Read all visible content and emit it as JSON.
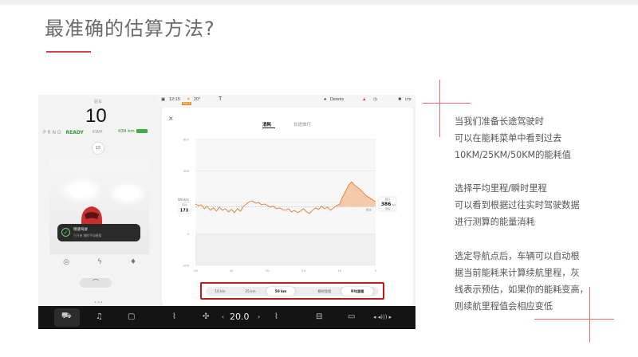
{
  "headline": "最准确的估算方法?",
  "car_panel": {
    "top_label": "驻车",
    "speed": "10",
    "gear": "P R N D",
    "ready": "READY",
    "speed_unit": "KM/H",
    "battery_range": "439 km",
    "speed_limit": "15",
    "toast_title": "稍速驾驶",
    "toast_body": "已开启 随时手动接管"
  },
  "status_bar": {
    "time": "12:15",
    "temperature": "20°",
    "air_badge": "PM2.5",
    "user": "Dennis",
    "connectivity": "LTE"
  },
  "dialog": {
    "close": "×",
    "tabs": [
      {
        "label": "消耗",
        "active": true
      },
      {
        "label": "长途旅行",
        "active": false
      }
    ],
    "range_segments": [
      {
        "label": "10 km",
        "selected": false
      },
      {
        "label": "25 km",
        "selected": false
      },
      {
        "label": "50 km",
        "selected": true
      },
      {
        "label": "瞬时里程",
        "selected": false
      },
      {
        "label": "平均里程",
        "selected": true
      }
    ]
  },
  "chart_data": {
    "type": "area",
    "ylabel": "Wh/km",
    "ylim": [
      -200,
      600
    ],
    "y_ticks": [
      "600",
      "400",
      "200",
      "0",
      "-200"
    ],
    "xlim": [
      -50,
      0
    ],
    "x_ticks": [
      "-50",
      "40",
      "30",
      "20",
      "10",
      "0"
    ],
    "avg_label": "平均",
    "avg_value": "173",
    "range_label": "预计",
    "range_value": "386",
    "range_unit": "km",
    "range_tag": "里程",
    "baseline_label": "额定",
    "baseline_value": 173,
    "y_values": [
      190,
      180,
      185,
      160,
      175,
      150,
      165,
      145,
      170,
      150,
      160,
      140,
      155,
      135,
      160,
      145,
      175,
      190,
      205,
      210,
      195,
      200,
      185,
      190,
      180,
      170,
      175,
      160,
      165,
      155,
      150,
      160,
      140,
      150,
      135,
      145,
      160,
      140,
      130,
      150,
      165,
      155,
      175,
      160,
      170,
      150,
      165,
      180,
      190,
      235,
      270,
      310,
      330,
      310,
      295,
      280,
      260,
      240,
      230,
      215,
      205
    ]
  },
  "right_text": {
    "p1": [
      "当我们准备长途驾驶时",
      "可以在能耗菜单中看到过去",
      "10KM/25KM/50KM的能耗值"
    ],
    "p2": [
      "选择平均里程/瞬时里程",
      "可以看到根据过往实时驾驶数据",
      "进行测算的能量消耗"
    ],
    "p3": [
      "选定导航点后，车辆可以自动根",
      "据当前能耗来计算续航里程，灰",
      "线表示预估，如果你的能耗变高，",
      "则续航里程值会相应变低"
    ]
  },
  "taskbar": {
    "temperature": "20.0",
    "volume": "◂ ◂))) ▸"
  },
  "colors": {
    "accent_red": "#d94049",
    "chart_line": "#e07b35",
    "chart_fill": "#f3a56b",
    "frame_red": "#c11a1a"
  }
}
